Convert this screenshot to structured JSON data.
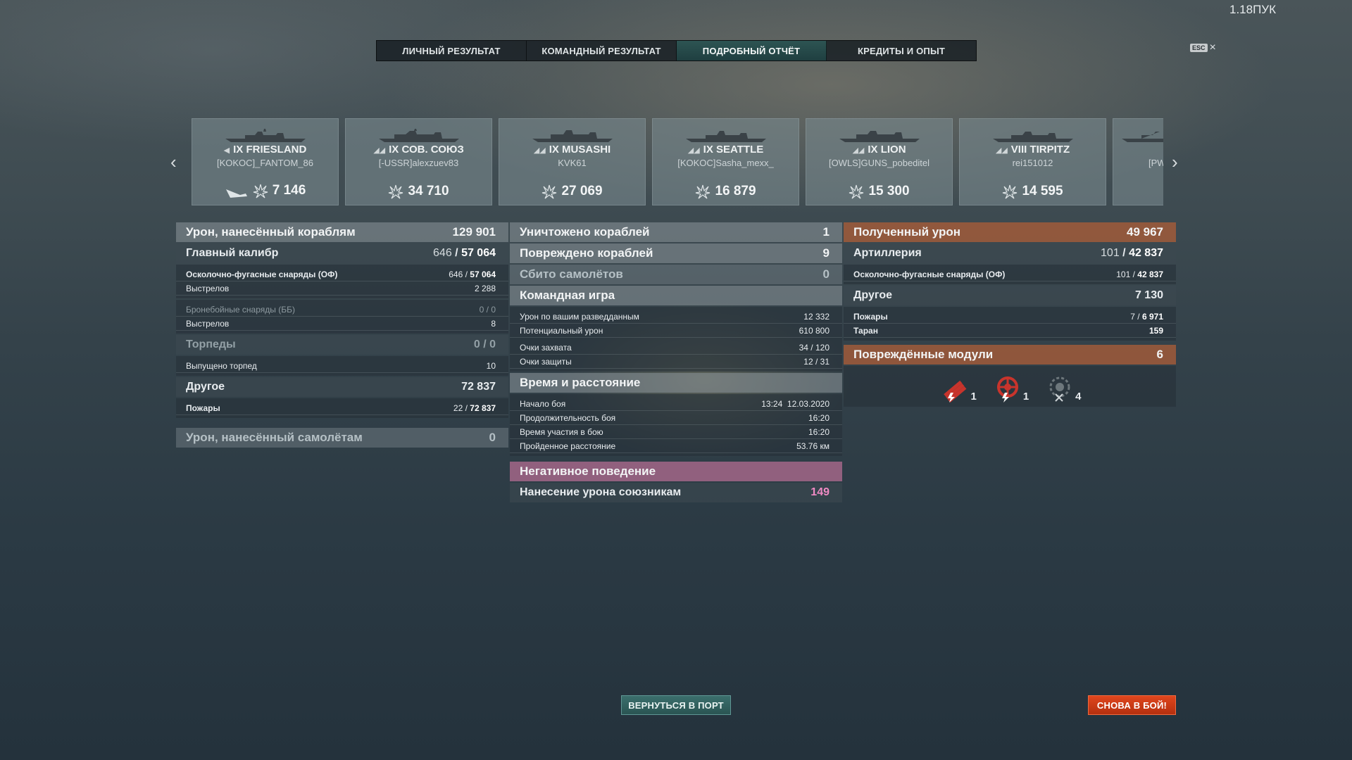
{
  "version": "1.18ПУК",
  "tabs": [
    "ЛИЧНЫЙ РЕЗУЛЬТАТ",
    "КОМАНДНЫЙ РЕЗУЛЬТАТ",
    "ПОДРОБНЫЙ ОТЧЁТ",
    "КРЕДИТЫ И ОПЫТ"
  ],
  "active_tab": "ПОДРОБНЫЙ ОТЧЁТ",
  "esc": {
    "key": "ESC",
    "close": "×"
  },
  "carousel": {
    "prev": "‹",
    "next": "›",
    "ships": [
      {
        "name": "IX FRIESLAND",
        "player": "[KOKOC]_FANTOM_86",
        "damage": "7 146"
      },
      {
        "name": "IX СОВ. СОЮЗ",
        "player": "[-USSR]alexzuev83",
        "damage": "34 710"
      },
      {
        "name": "IX MUSASHI",
        "player": "KVK61",
        "damage": "27 069"
      },
      {
        "name": "IX SEATTLE",
        "player": "[KOKOC]Sasha_mexx_",
        "damage": "16 879"
      },
      {
        "name": "IX LION",
        "player": "[OWLS]GUNS_pobeditel",
        "damage": "15 300"
      },
      {
        "name": "VIII TIRPITZ",
        "player": "rei151012",
        "damage": "14 595"
      },
      {
        "name": "",
        "player": "[PW",
        "damage": ""
      }
    ]
  },
  "left": {
    "ship_damage": {
      "label": "Урон, нанесённый кораблям",
      "value": "129 901"
    },
    "main_battery": {
      "label": "Главный калибр",
      "a": "646",
      "b": "57 064"
    },
    "he": {
      "label": "Осколочно-фугасные снаряды (ОФ)",
      "a": "646",
      "b": "57 064"
    },
    "he_shots": {
      "label": "Выстрелов",
      "value": "2 288"
    },
    "ap": {
      "label": "Бронебойные снаряды (ББ)",
      "value": "0 / 0"
    },
    "ap_shots": {
      "label": "Выстрелов",
      "value": "8"
    },
    "torpedoes": {
      "label": "Торпеды",
      "value": "0 / 0"
    },
    "torps_launched": {
      "label": "Выпущено торпед",
      "value": "10"
    },
    "other": {
      "label": "Другое",
      "value": "72 837"
    },
    "fires": {
      "label": "Пожары",
      "a": "22",
      "b": "72 837"
    },
    "plane_damage": {
      "label": "Урон, нанесённый самолётам",
      "value": "0"
    }
  },
  "middle": {
    "destroyed": {
      "label": "Уничтожено кораблей",
      "value": "1"
    },
    "damaged": {
      "label": "Повреждено кораблей",
      "value": "9"
    },
    "planes": {
      "label": "Сбито самолётов",
      "value": "0"
    },
    "team": {
      "label": "Командная игра"
    },
    "spotting": {
      "label": "Урон по вашим разведданным",
      "value": "12 332"
    },
    "potential": {
      "label": "Потенциальный урон",
      "value": "610 800"
    },
    "capture": {
      "label": "Очки захвата",
      "value": "34 / 120"
    },
    "defense": {
      "label": "Очки защиты",
      "value": "12 / 31"
    },
    "time": {
      "label": "Время и расстояние"
    },
    "start": {
      "label": "Начало боя",
      "value": "13:24  12.03.2020"
    },
    "duration": {
      "label": "Продолжительность боя",
      "value": "16:20"
    },
    "participation": {
      "label": "Время участия в бою",
      "value": "16:20"
    },
    "distance": {
      "label": "Пройденное расстояние",
      "value": "53.76 км"
    },
    "negative": {
      "label": "Негативное поведение"
    },
    "team_damage": {
      "label": "Нанесение урона союзникам",
      "value": "149"
    }
  },
  "right": {
    "received": {
      "label": "Полученный урон",
      "value": "49 967"
    },
    "artillery": {
      "label": "Артиллерия",
      "a": "101",
      "b": "42 837"
    },
    "he": {
      "label": "Осколочно-фугасные снаряды (ОФ)",
      "a": "101",
      "b": "42 837"
    },
    "other": {
      "label": "Другое",
      "value": "7 130"
    },
    "fires": {
      "label": "Пожары",
      "a": "7",
      "b": "6 971"
    },
    "ram": {
      "label": "Таран",
      "value": "159"
    },
    "modules": {
      "label": "Повреждённые модули",
      "value": "6"
    },
    "module_icons": [
      {
        "icon": "torpedo-tubes-icon",
        "count": "1"
      },
      {
        "icon": "steering-gear-icon",
        "count": "1"
      },
      {
        "icon": "aa-gun-destroyed-icon",
        "count": "4"
      }
    ]
  },
  "buttons": {
    "port": "ВЕРНУТЬСЯ В ПОРТ",
    "battle": "СНОВА В БОЙ!"
  }
}
